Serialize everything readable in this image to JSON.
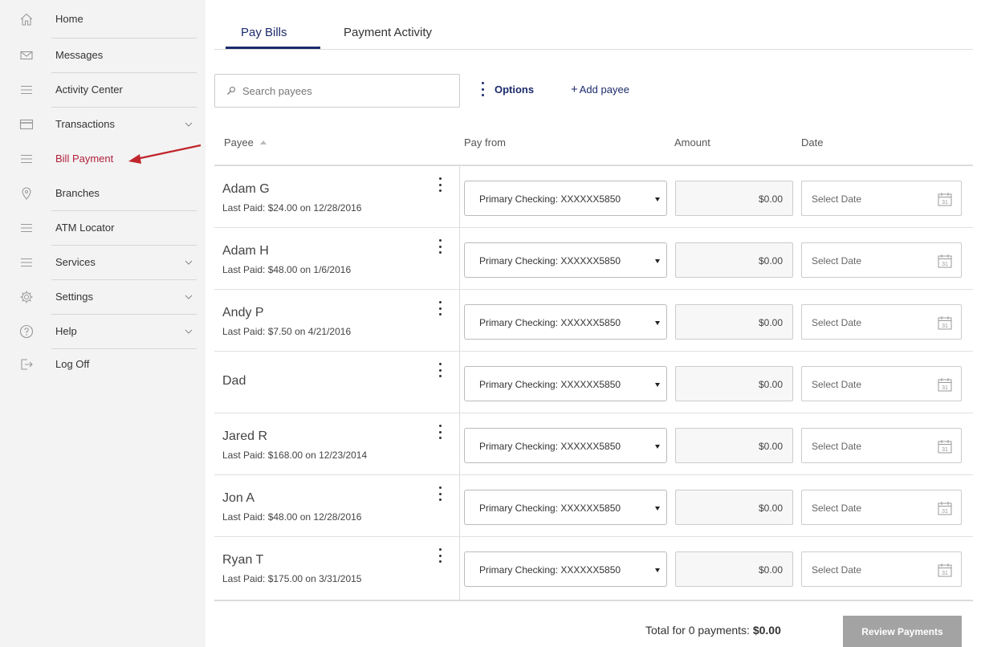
{
  "sidebar": {
    "items": [
      {
        "label": "Home",
        "icon": "home-icon"
      },
      {
        "label": "Messages",
        "icon": "envelope-icon"
      },
      {
        "label": "Activity Center",
        "icon": "menu-icon"
      },
      {
        "label": "Transactions",
        "icon": "card-icon",
        "expandable": true
      },
      {
        "label": "Bill Payment",
        "icon": "menu-icon",
        "active": true
      },
      {
        "label": "Branches",
        "icon": "location-pin-icon"
      },
      {
        "label": "ATM Locator",
        "icon": "menu-icon"
      },
      {
        "label": "Services",
        "icon": "menu-icon",
        "expandable": true
      },
      {
        "label": "Settings",
        "icon": "gear-icon",
        "expandable": true
      },
      {
        "label": "Help",
        "icon": "question-icon",
        "expandable": true
      },
      {
        "label": "Log Off",
        "icon": "logout-icon"
      }
    ],
    "active_color": "#b1213e"
  },
  "tabs": [
    {
      "label": "Pay Bills",
      "active": true
    },
    {
      "label": "Payment Activity",
      "active": false
    }
  ],
  "toolbar": {
    "search_placeholder": "Search payees",
    "options_label": "Options",
    "add_payee_plus": "+",
    "add_payee_label": "Add payee"
  },
  "columns": {
    "payee": "Payee",
    "pay_from": "Pay from",
    "amount": "Amount",
    "date": "Date"
  },
  "payees": [
    {
      "name": "Adam G",
      "last_paid": "Last Paid: $24.00 on 12/28/2016",
      "account": "Primary Checking: XXXXXX5850",
      "amount": "$0.00",
      "date_placeholder": "Select Date"
    },
    {
      "name": "Adam H",
      "last_paid": "Last Paid: $48.00 on 1/6/2016",
      "account": "Primary Checking: XXXXXX5850",
      "amount": "$0.00",
      "date_placeholder": "Select Date"
    },
    {
      "name": "Andy P",
      "last_paid": "Last Paid: $7.50 on 4/21/2016",
      "account": "Primary Checking: XXXXXX5850",
      "amount": "$0.00",
      "date_placeholder": "Select Date"
    },
    {
      "name": "Dad",
      "last_paid": "",
      "account": "Primary Checking: XXXXXX5850",
      "amount": "$0.00",
      "date_placeholder": "Select Date"
    },
    {
      "name": "Jared R",
      "last_paid": "Last Paid: $168.00 on 12/23/2014",
      "account": "Primary Checking: XXXXXX5850",
      "amount": "$0.00",
      "date_placeholder": "Select Date"
    },
    {
      "name": "Jon A",
      "last_paid": "Last Paid: $48.00 on 12/28/2016",
      "account": "Primary Checking: XXXXXX5850",
      "amount": "$0.00",
      "date_placeholder": "Select Date"
    },
    {
      "name": "Ryan T",
      "last_paid": "Last Paid: $175.00 on 3/31/2015",
      "account": "Primary Checking: XXXXXX5850",
      "amount": "$0.00",
      "date_placeholder": "Select Date"
    }
  ],
  "calendar_icon_day": "31",
  "footer": {
    "total_label": "Total for 0 payments:",
    "total_amount": "$0.00",
    "review_button": "Review Payments"
  },
  "colors": {
    "brand_navy": "#1c2b6b",
    "annotation_arrow": "#c0262c",
    "review_button_bg": "#a3a3a3"
  }
}
